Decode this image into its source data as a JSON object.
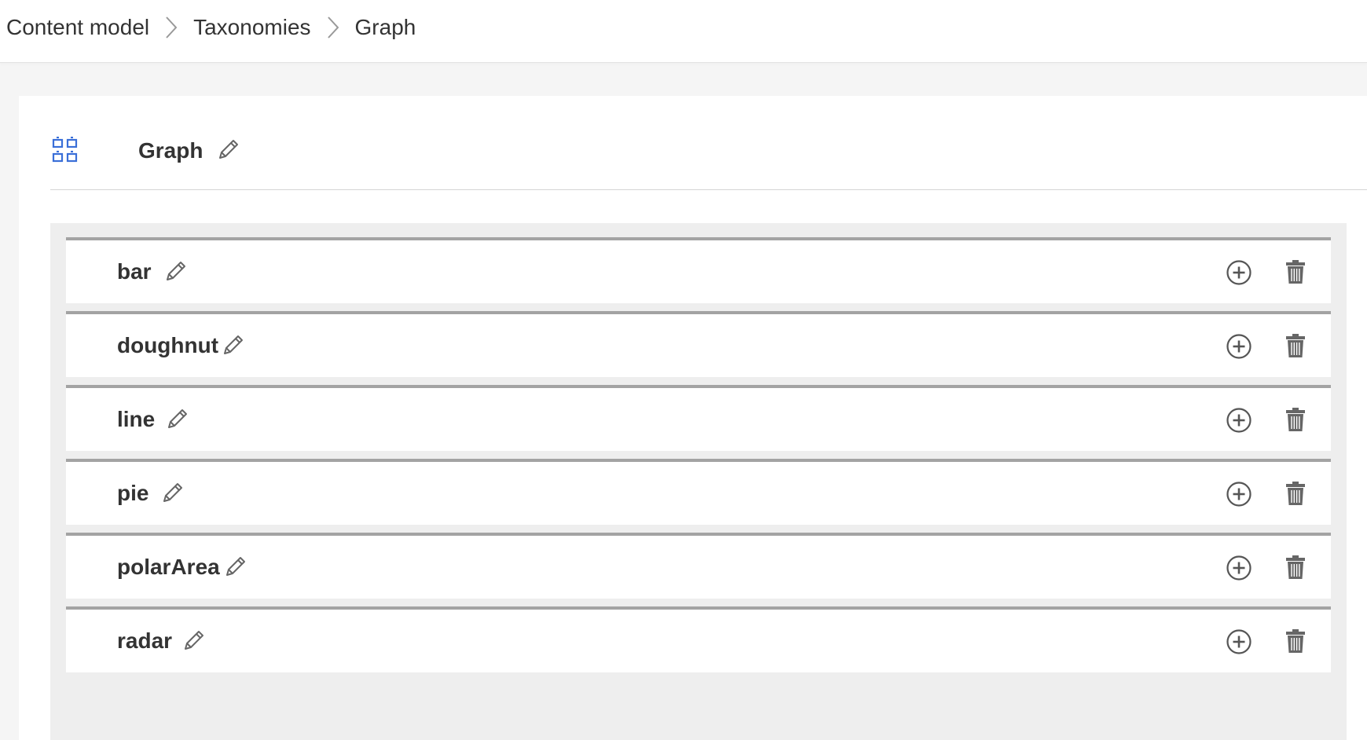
{
  "breadcrumb": {
    "items": [
      "Content model",
      "Taxonomies",
      "Graph"
    ]
  },
  "taxonomy": {
    "title": "Graph",
    "icon": "taxonomy-grid-icon",
    "accent_color": "#3a6fd8"
  },
  "terms": [
    {
      "label": "bar"
    },
    {
      "label": "doughnut"
    },
    {
      "label": "line"
    },
    {
      "label": "pie"
    },
    {
      "label": "polarArea"
    },
    {
      "label": "radar"
    }
  ],
  "icons": {
    "edit": "pencil-icon",
    "add": "plus-circle-icon",
    "delete": "trash-icon",
    "separator": "chevron-right-icon"
  }
}
